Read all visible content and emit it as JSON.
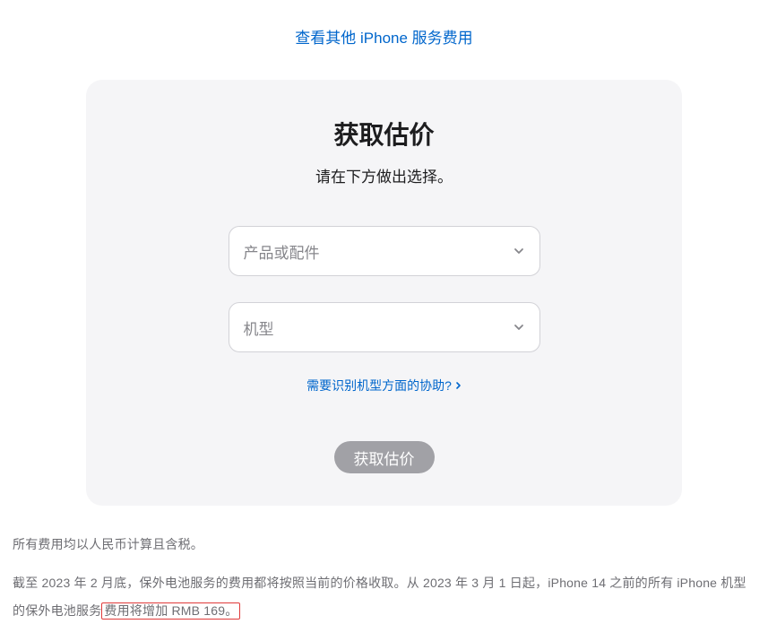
{
  "topLink": {
    "label": "查看其他 iPhone 服务费用"
  },
  "card": {
    "title": "获取估价",
    "subtitle": "请在下方做出选择。",
    "productSelect": {
      "placeholder": "产品或配件"
    },
    "modelSelect": {
      "placeholder": "机型"
    },
    "helpLink": {
      "label": "需要识别机型方面的协助?"
    },
    "submitButton": {
      "label": "获取估价"
    }
  },
  "footnotes": {
    "line1": "所有费用均以人民币计算且含税。",
    "line2_part1": "截至 2023 年 2 月底，保外电池服务的费用都将按照当前的价格收取。从 2023 年 3 月 1 日起，iPhone 14 之前的所有 iPhone 机型的保外电池服务",
    "line2_highlight": "费用将增加 RMB 169。"
  }
}
